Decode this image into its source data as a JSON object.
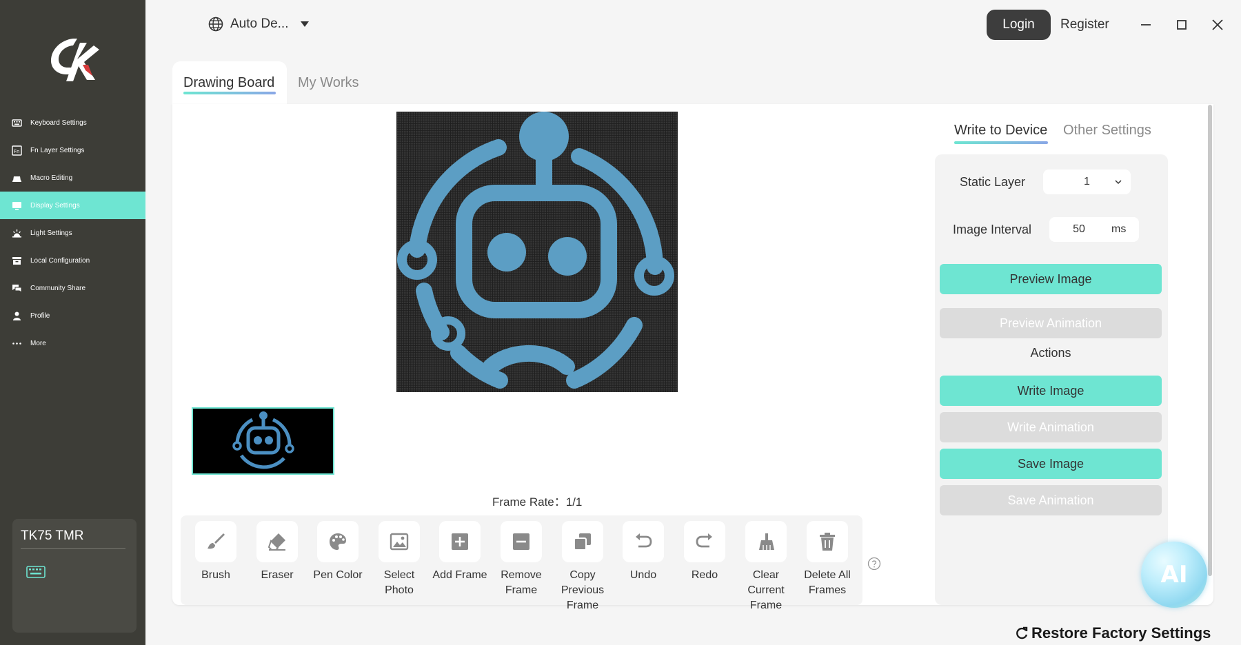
{
  "language": {
    "label": "Auto De..."
  },
  "auth": {
    "login": "Login",
    "register": "Register"
  },
  "sidebar": {
    "items": [
      {
        "label": "Keyboard Settings",
        "icon": "keyboard-icon"
      },
      {
        "label": "Fn Layer Settings",
        "icon": "fn-icon"
      },
      {
        "label": "Macro Editing",
        "icon": "macro-icon"
      },
      {
        "label": "Display Settings",
        "icon": "display-icon",
        "active": true
      },
      {
        "label": "Light Settings",
        "icon": "light-icon"
      },
      {
        "label": "Local Configuration",
        "icon": "archive-icon"
      },
      {
        "label": "Community Share",
        "icon": "chat-icon"
      },
      {
        "label": "Profile",
        "icon": "person-icon"
      },
      {
        "label": "More",
        "icon": "more-icon"
      }
    ],
    "device": {
      "name": "TK75 TMR"
    }
  },
  "tabs": {
    "drawing_board": "Drawing Board",
    "my_works": "My Works"
  },
  "canvas": {
    "frame_rate_label": "Frame Rate：",
    "frame_rate_value": "1/1"
  },
  "toolbar": {
    "tools": [
      {
        "label": "Brush",
        "icon": "brush-icon"
      },
      {
        "label": "Eraser",
        "icon": "eraser-icon"
      },
      {
        "label": "Pen Color",
        "icon": "palette-icon"
      },
      {
        "label": "Select Photo",
        "icon": "image-icon"
      },
      {
        "label": "Add Frame",
        "icon": "add-frame-icon"
      },
      {
        "label": "Remove Frame",
        "icon": "remove-frame-icon"
      },
      {
        "label": "Copy Previous Frame",
        "icon": "copy-icon"
      },
      {
        "label": "Undo",
        "icon": "undo-icon"
      },
      {
        "label": "Redo",
        "icon": "redo-icon"
      },
      {
        "label": "Clear Current Frame",
        "icon": "clear-icon"
      },
      {
        "label": "Delete All Frames",
        "icon": "trash-icon"
      }
    ]
  },
  "right": {
    "tab_write": "Write to Device",
    "tab_other": "Other Settings",
    "static_layer_label": "Static Layer",
    "static_layer_value": "1",
    "image_interval_label": "Image Interval",
    "image_interval_value": "50",
    "image_interval_unit": "ms",
    "preview_image": "Preview Image",
    "preview_animation": "Preview Animation",
    "actions_label": "Actions",
    "write_image": "Write Image",
    "write_animation": "Write Animation",
    "save_image": "Save Image",
    "save_animation": "Save Animation"
  },
  "ai": {
    "label": "AI"
  },
  "footer": {
    "restore": "Restore Factory Settings"
  },
  "colors": {
    "accent": "#6ee5d2",
    "sidebar": "#3d3d37",
    "robot": "#5c9ec4",
    "disabled": "#dcdcdc"
  }
}
